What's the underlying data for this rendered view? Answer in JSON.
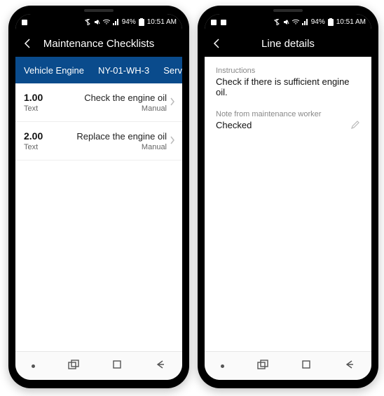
{
  "status": {
    "battery_pct": "94%",
    "time": "10:51 AM"
  },
  "left": {
    "title": "Maintenance Checklists",
    "tabs": {
      "engine": "Vehicle Engine",
      "asset": "NY-01-WH-3",
      "service": "Service"
    },
    "rows": [
      {
        "num": "1.00",
        "sub": "Text",
        "desc": "Check the engine oil",
        "mode": "Manual"
      },
      {
        "num": "2.00",
        "sub": "Text",
        "desc": "Replace the engine oil",
        "mode": "Manual"
      }
    ]
  },
  "right": {
    "title": "Line details",
    "instructions_label": "Instructions",
    "instructions_value": "Check if there is sufficient engine oil.",
    "note_label": "Note from maintenance worker",
    "note_value": "Checked"
  }
}
